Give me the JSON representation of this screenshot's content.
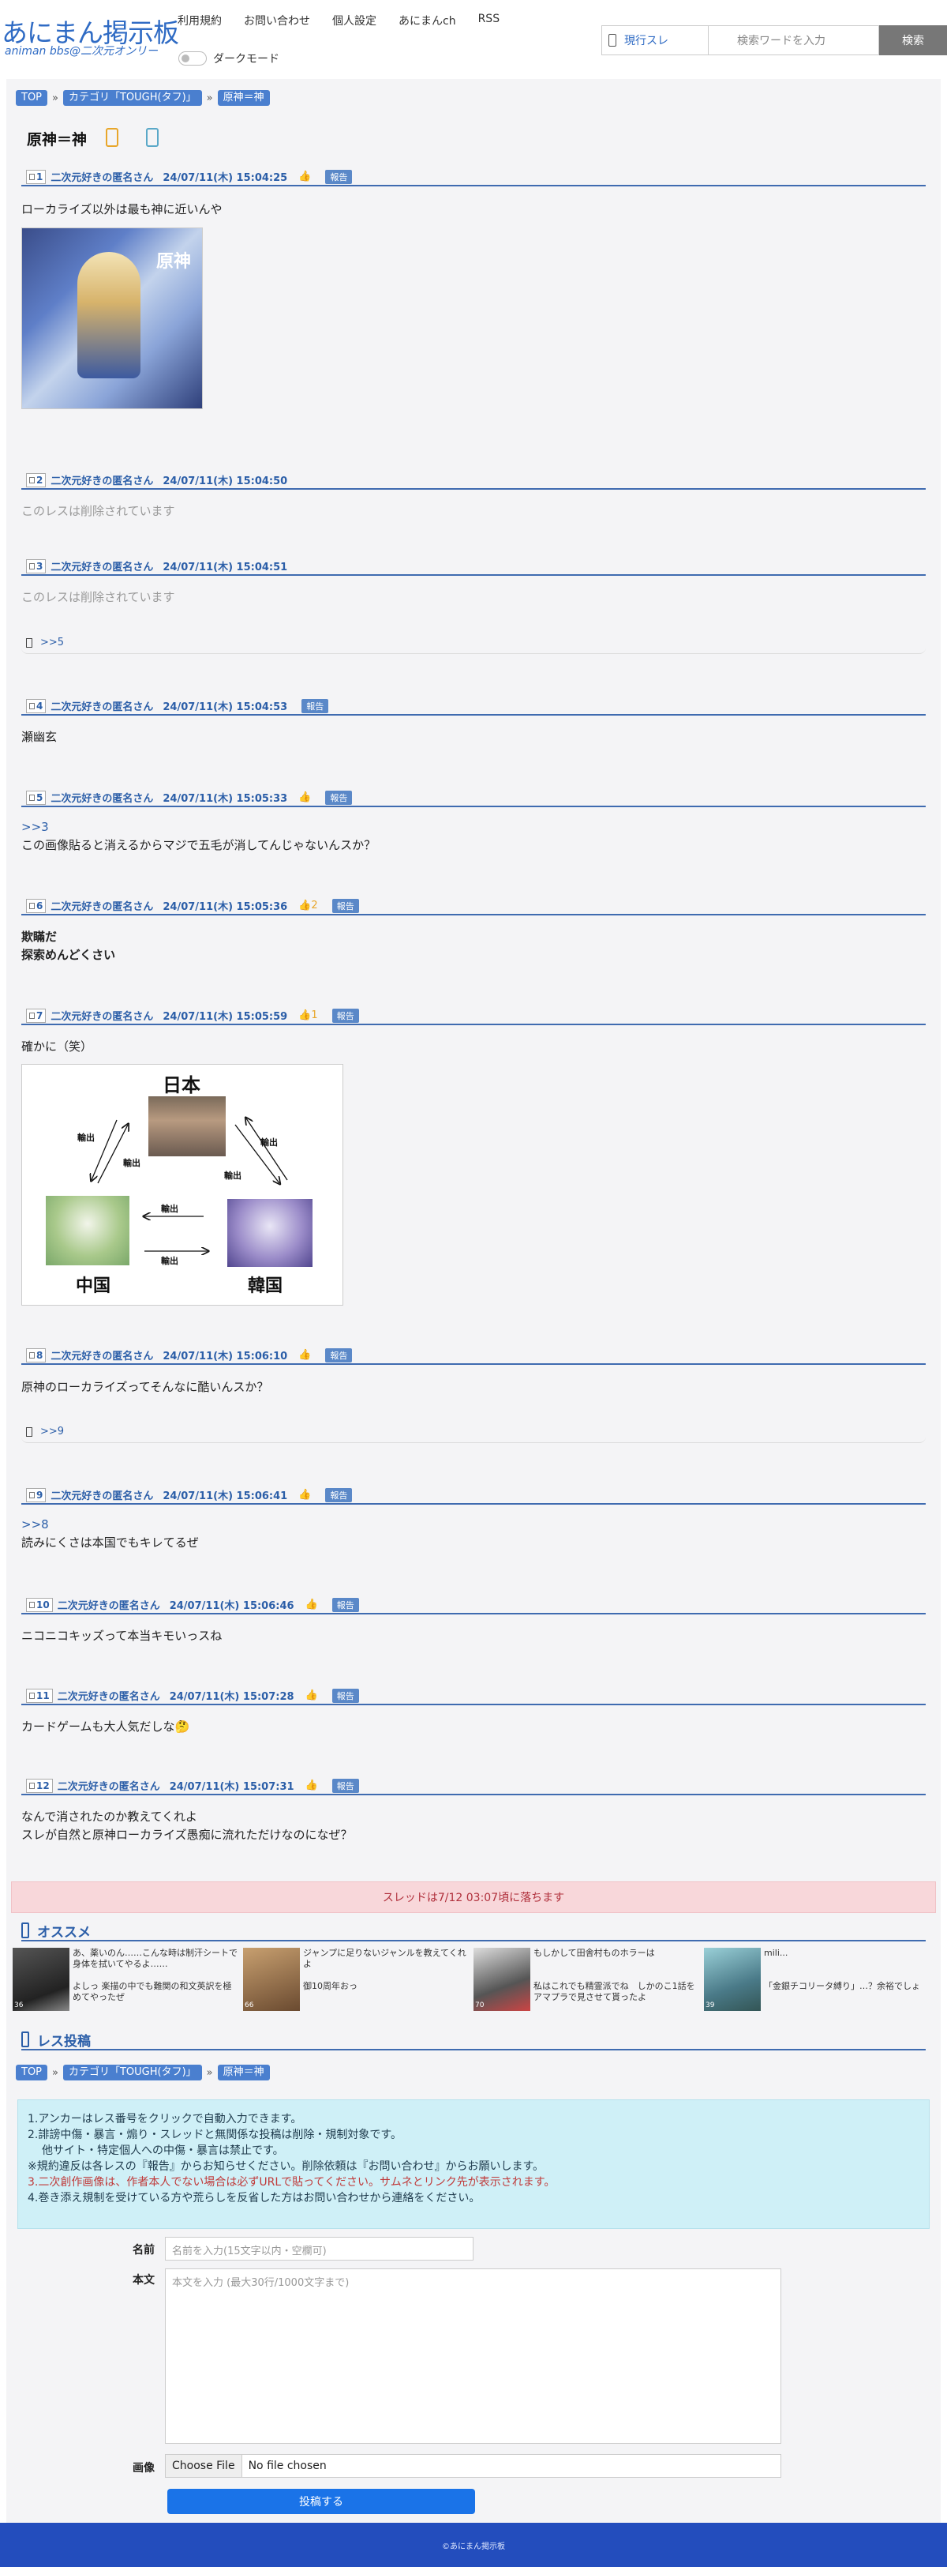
{
  "header": {
    "logo": "あにまん掲示板",
    "logo_sub": "animan bbs@二次元オンリー",
    "nav": [
      "利用規約",
      "お問い合わせ",
      "個人設定",
      "あにまんch",
      "RSS"
    ],
    "dark_mode_label": "ダークモード",
    "search_scope": "現行スレ",
    "search_placeholder": "検索ワードを入力",
    "search_button": "検索"
  },
  "breadcrumb": [
    "TOP",
    "カテゴリ「TOUGH(タフ)」",
    "原神＝神"
  ],
  "thread": {
    "title": "原神＝神",
    "posts": [
      {
        "num": "1",
        "name": "二次元好きの匿名さん",
        "date": "24/07/11(木) 15:04:25",
        "report": "報告",
        "text": [
          "ローカライズ以外は最も神に近いんや"
        ]
      },
      {
        "num": "2",
        "name": "二次元好きの匿名さん",
        "date": "24/07/11(木) 15:04:50",
        "text": [
          "このレスは削除されています"
        ]
      },
      {
        "num": "3",
        "name": "二次元好きの匿名さん",
        "date": "24/07/11(木) 15:04:51",
        "text": [
          "このレスは削除されています"
        ],
        "reply": ">>5"
      },
      {
        "num": "4",
        "name": "二次元好きの匿名さん",
        "date": "24/07/11(木) 15:04:53",
        "report": "報告",
        "text": [
          "瀬幽玄"
        ]
      },
      {
        "num": "5",
        "name": "二次元好きの匿名さん",
        "date": "24/07/11(木) 15:05:33",
        "report": "報告",
        "anchor": ">>3",
        "text": [
          "この画像貼ると消えるからマジで五毛が消してんじゃないんスか？"
        ]
      },
      {
        "num": "6",
        "name": "二次元好きの匿名さん",
        "date": "24/07/11(木) 15:05:36",
        "count": "2",
        "report": "報告",
        "text": [
          "欺瞞だ",
          "探索めんどくさい"
        ]
      },
      {
        "num": "7",
        "name": "二次元好きの匿名さん",
        "date": "24/07/11(木) 15:05:59",
        "count": "1",
        "report": "報告",
        "text": [
          "確かに（笑）"
        ]
      },
      {
        "num": "8",
        "name": "二次元好きの匿名さん",
        "date": "24/07/11(木) 15:06:10",
        "report": "報告",
        "text": [
          "原神のローカライズってそんなに酷いんスか？"
        ],
        "reply": ">>9"
      },
      {
        "num": "9",
        "name": "二次元好きの匿名さん",
        "date": "24/07/11(木) 15:06:41",
        "report": "報告",
        "anchor": ">>8",
        "text": [
          "読みにくさは本国でもキレてるぜ"
        ]
      },
      {
        "num": "10",
        "name": "二次元好きの匿名さん",
        "date": "24/07/11(木) 15:06:46",
        "report": "報告",
        "text": [
          "ニコニコキッズって本当キモいっスね"
        ]
      },
      {
        "num": "11",
        "name": "二次元好きの匿名さん",
        "date": "24/07/11(木) 15:07:28",
        "report": "報告",
        "text": [
          "カードゲームも大人気だしな🤔"
        ]
      },
      {
        "num": "12",
        "name": "二次元好きの匿名さん",
        "date": "24/07/11(木) 15:07:31",
        "report": "報告",
        "text": [
          "なんで消されたのか教えてくれよ",
          "スレが自然と原神ローカライズ愚痴に流れただけなのになぜ？"
        ]
      }
    ]
  },
  "image1": {
    "logo_text": "原神"
  },
  "image2": {
    "top": "日本",
    "left": "中国",
    "right": "韓国",
    "arrow": "輸出"
  },
  "sunset": "スレッドは7/12 03:07頃に落ちます",
  "recommend": {
    "title": "オススメ",
    "items": [
      {
        "text": "あ、薬いのん……こんな時は制汗シートで身体を拭いてやるよ……",
        "count": "36"
      },
      {
        "text": "よしっ 楽描の中でも難関の和文英訳を極めてやったぜ",
        "count": ""
      },
      {
        "text": "ジャンプに足りないジャンルを教えてくれよ",
        "count": "66"
      },
      {
        "text": "御10周年おっ",
        "count": ""
      },
      {
        "text": "もしかして田舎村ものホラーは",
        "count": "70"
      },
      {
        "text": "私はこれでも精霊派でね　しかのこ1話をアマプラで見させて貰ったよ",
        "count": ""
      },
      {
        "text": "mili...",
        "count": "39"
      },
      {
        "text": "「金銀チコリータ縛り」…？余裕でしょ",
        "count": ""
      }
    ]
  },
  "post_form": {
    "title": "レス投稿",
    "notice": [
      "1.アンカーはレス番号をクリックで自動入力できます。",
      "2.誹謗中傷・暴言・煽り・スレッドと無関係な投稿は削除・規制対象です。",
      "他サイト・特定個人への中傷・暴言は禁止です。",
      "※規約違反は各レスの『報告』からお知らせください。削除依頼は『お問い合わせ』からお願いします。",
      "3.二次創作画像は、作者本人でない場合は必ずURLで貼ってください。サムネとリンク先が表示されます。",
      "4.巻き添え規制を受けている方や荒らしを反省した方はお問い合わせから連絡をください。"
    ],
    "name_label": "名前",
    "name_placeholder": "名前を入力(15文字以内・空欄可)",
    "body_label": "本文",
    "body_placeholder": "本文を入力 (最大30行/1000文字まで)",
    "image_label": "画像",
    "file_button": "Choose File",
    "file_status": "No file chosen",
    "submit": "投稿する"
  },
  "footer": "©あにまん掲示板",
  "colors": {
    "accent": "#2f6bc4",
    "header_line": "#3f6bb0",
    "report": "#5a88c8",
    "footer": "#234dbd",
    "notice_bg": "#cff0f7",
    "sunset_bg": "#f8d7da"
  }
}
